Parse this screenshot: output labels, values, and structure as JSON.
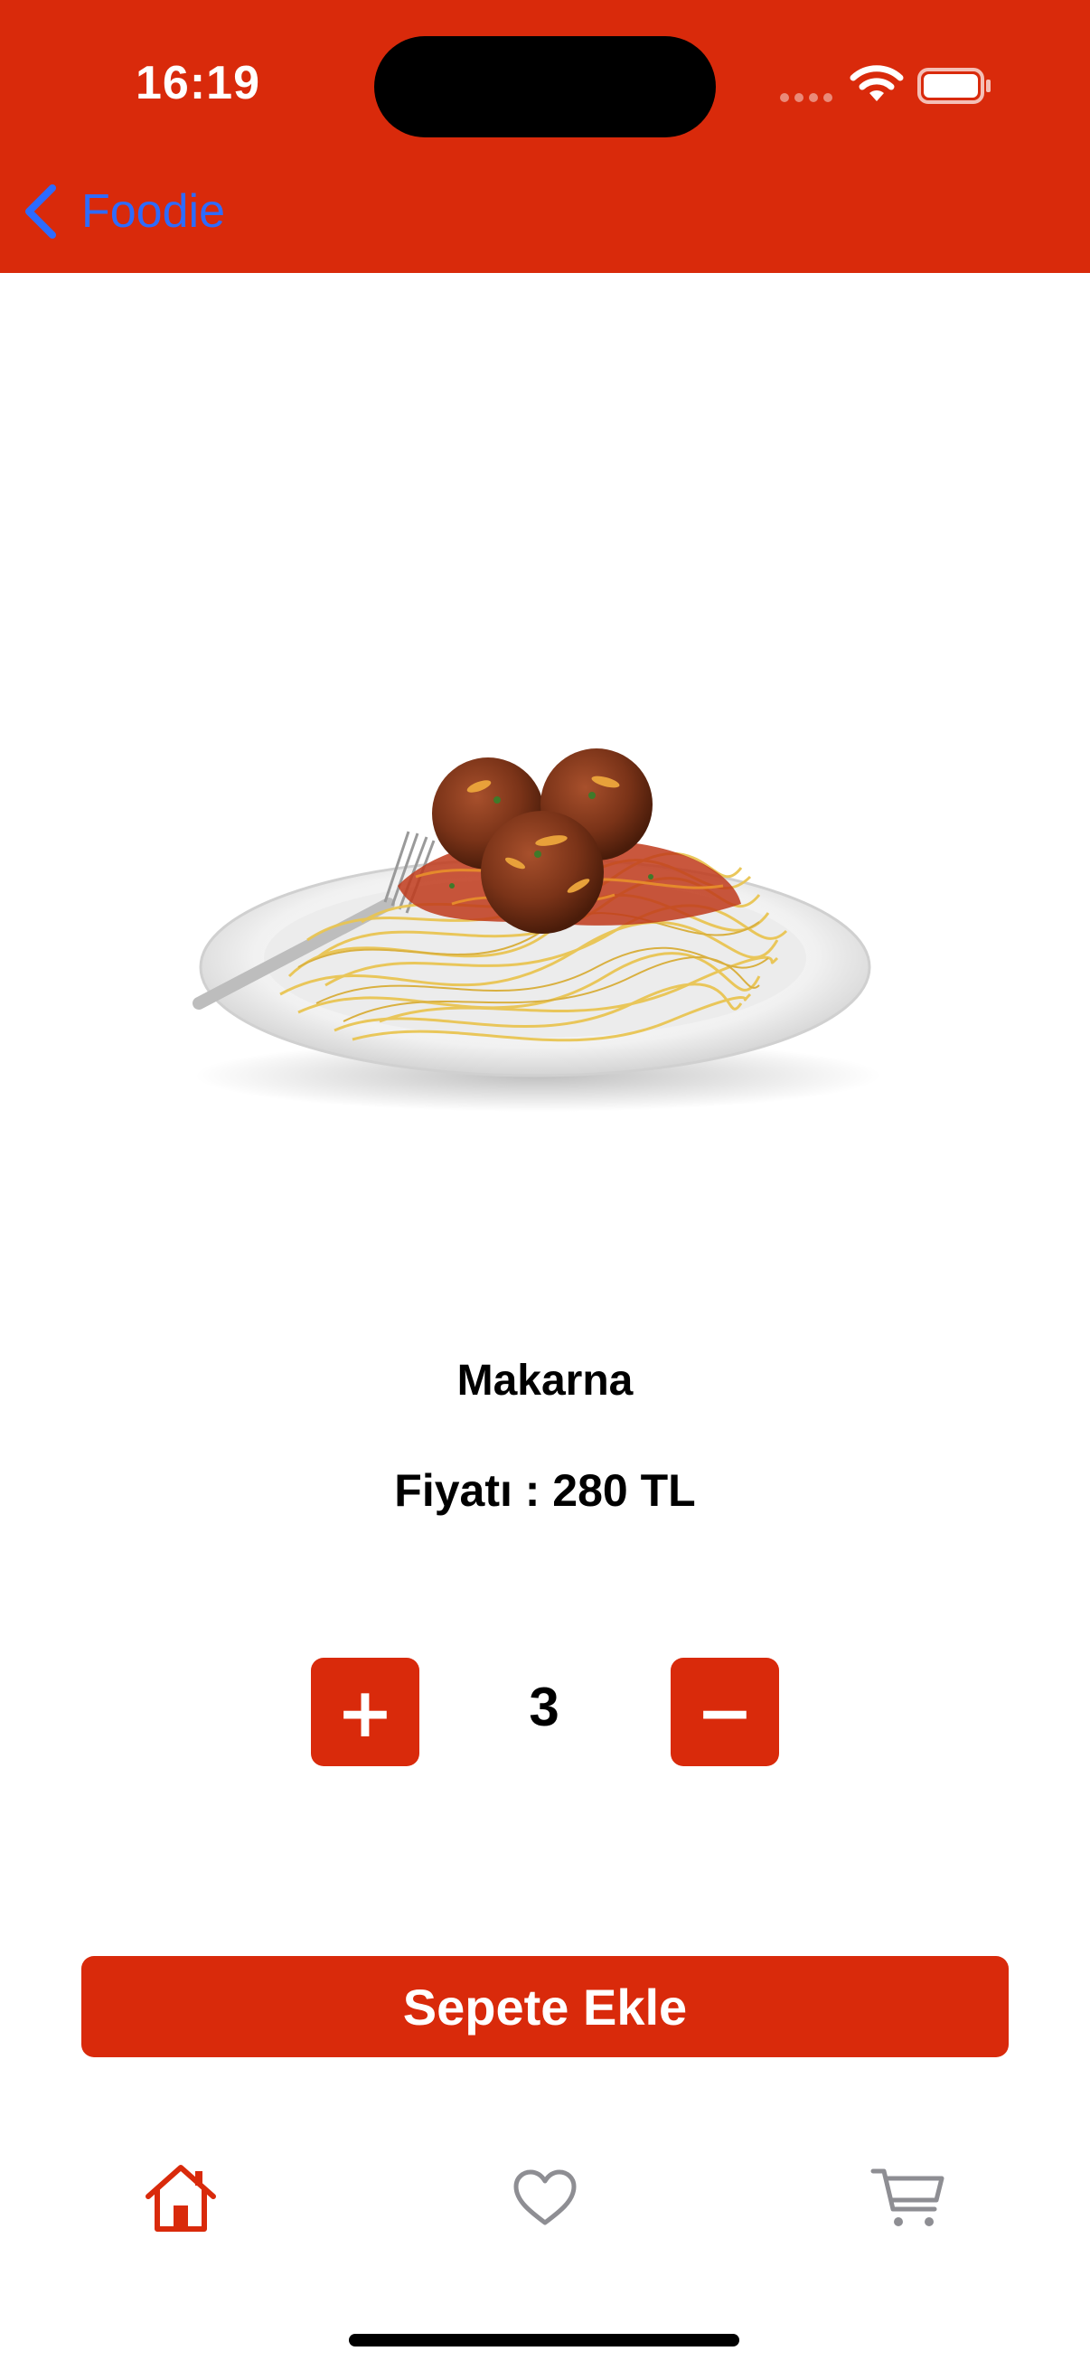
{
  "status_bar": {
    "time": "16:19"
  },
  "nav": {
    "back_label": "Foodie"
  },
  "product": {
    "name": "Makarna",
    "price_text": "Fiyatı : 280 TL",
    "quantity": "3"
  },
  "controls": {
    "plus_label": "+",
    "minus_label": "−",
    "add_to_cart_label": "Sepete Ekle"
  },
  "tabs": [
    {
      "icon": "home-icon",
      "active": true
    },
    {
      "icon": "heart-icon",
      "active": false
    },
    {
      "icon": "cart-icon",
      "active": false
    }
  ],
  "colors": {
    "accent": "#d92a0b",
    "link": "#2d6bff",
    "inactive_tab": "#8e8e93"
  }
}
